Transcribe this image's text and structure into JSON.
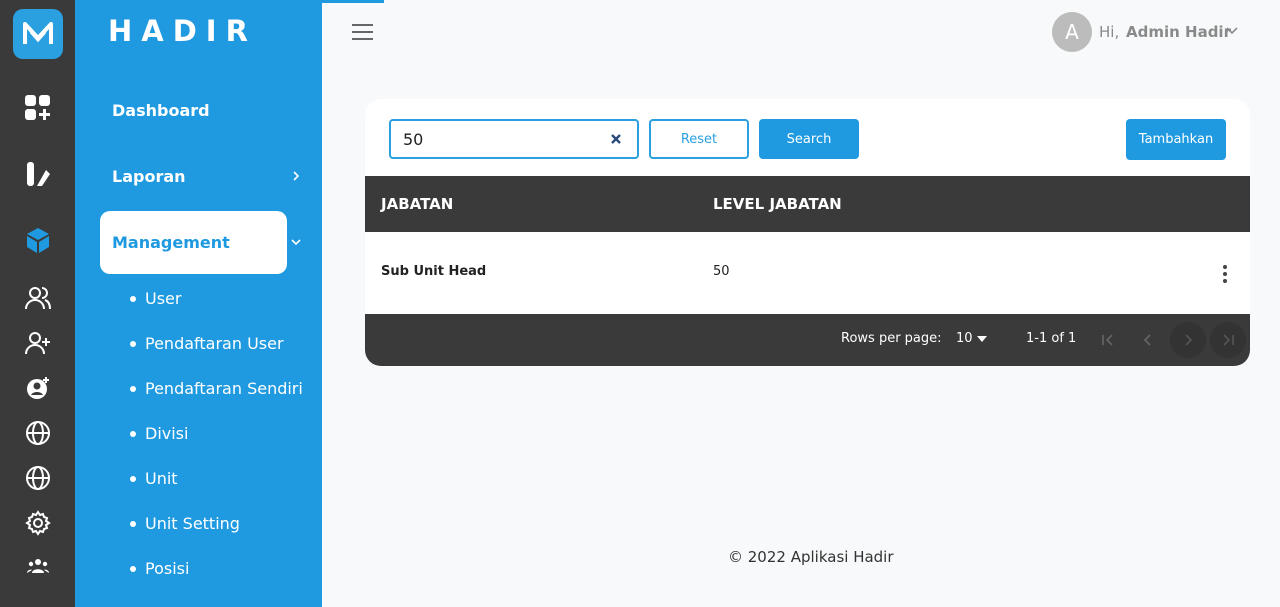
{
  "brand": "HADIR",
  "header": {
    "greeting": "Hi,",
    "user_name": "Admin Hadir",
    "avatar_letter": "A"
  },
  "sidebar": {
    "items": [
      {
        "label": "Dashboard"
      },
      {
        "label": "Laporan"
      },
      {
        "label": "Management"
      }
    ],
    "subitems": [
      "User",
      "Pendaftaran User",
      "Pendaftaran Sendiri",
      "Divisi",
      "Unit",
      "Unit Setting",
      "Posisi"
    ]
  },
  "toolbar": {
    "search_value": "50",
    "reset_label": "Reset",
    "search_label": "Search",
    "add_label": "Tambahkan"
  },
  "table": {
    "columns": [
      "JABATAN",
      "LEVEL JABATAN"
    ],
    "rows": [
      {
        "jabatan": "Sub Unit Head",
        "level": "50"
      }
    ],
    "rows_per_page_label": "Rows per page:",
    "rows_per_page": "10",
    "range": "1-1 of 1"
  },
  "footer": "© 2022 Aplikasi Hadir",
  "colors": {
    "primary": "#1f9ae0",
    "dark": "#3a3a3a"
  }
}
